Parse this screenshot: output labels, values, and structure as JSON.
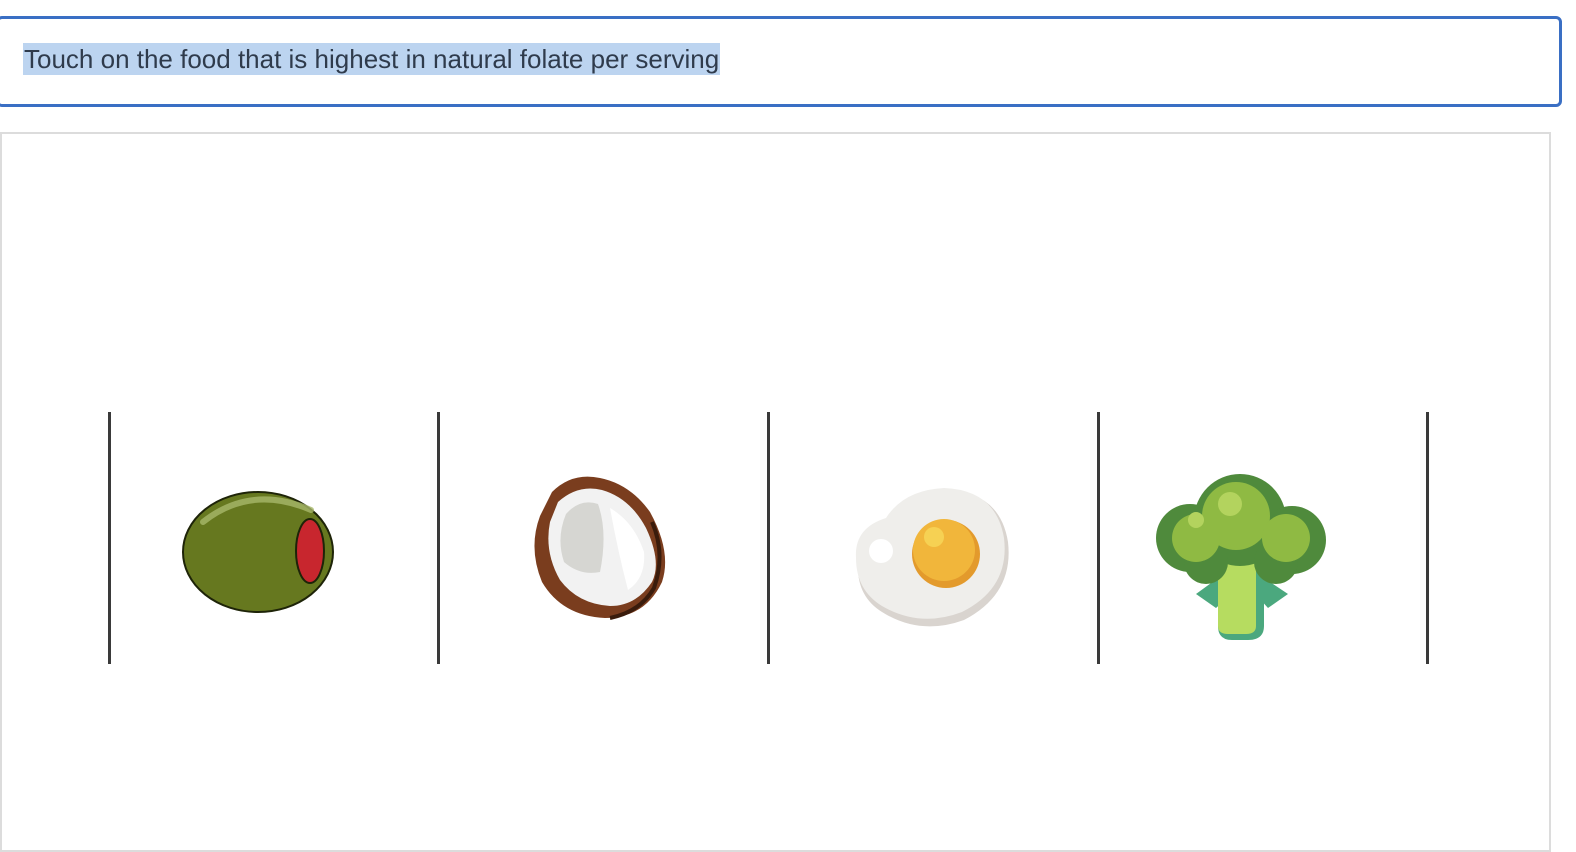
{
  "prompt": {
    "text": "Touch on the food that is highest in natural folate per serving"
  },
  "choices": [
    {
      "id": "olive",
      "icon": "olive-icon"
    },
    {
      "id": "coconut",
      "icon": "coconut-icon"
    },
    {
      "id": "egg",
      "icon": "fried-egg-icon"
    },
    {
      "id": "broccoli",
      "icon": "broccoli-icon"
    }
  ],
  "colors": {
    "prompt_border": "#3a6fc4",
    "prompt_highlight": "#bcd4f0",
    "olive": "#66781f",
    "pimento": "#c8262e",
    "coconut_shell": "#7a3d1e",
    "egg_yolk": "#eab13a",
    "broccoli": "#4f8a3c"
  }
}
